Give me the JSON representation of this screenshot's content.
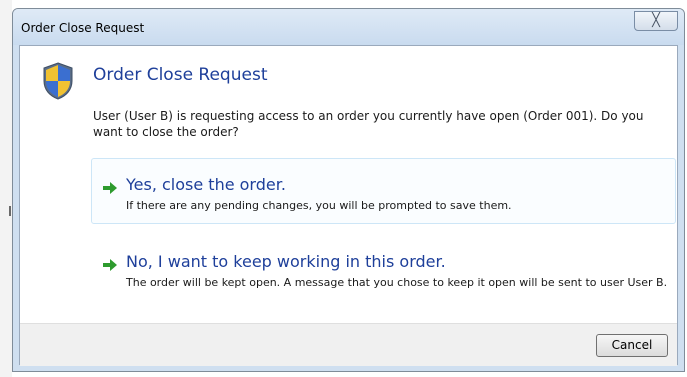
{
  "window": {
    "title": "Order Close Request",
    "close_glyph": "╳"
  },
  "dialog": {
    "heading": "Order Close Request",
    "message": "User (User B) is requesting access to an order you currently have open (Order 001). Do you want to close the order?",
    "icon": "uac-shield-icon"
  },
  "options": [
    {
      "title": "Yes, close the order.",
      "description": "If there are any pending changes, you will be prompted to save them.",
      "icon": "green-arrow-icon"
    },
    {
      "title": "No, I want to keep working in this order.",
      "description": "The order will be kept open. A message that you chose to keep it open will be sent to user User B.",
      "icon": "green-arrow-icon"
    }
  ],
  "footer": {
    "cancel_label": "Cancel"
  },
  "colors": {
    "heading": "#1e3f9a",
    "arrow": "#2e9b2e",
    "titlebar": "#cfdff0"
  }
}
